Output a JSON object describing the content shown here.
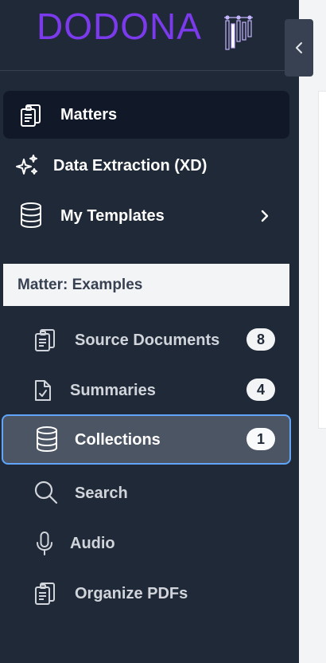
{
  "brand": {
    "logo_text": "DODONA"
  },
  "nav": {
    "matters": "Matters",
    "data_extraction": "Data Extraction (XD)",
    "my_templates": "My Templates"
  },
  "matter": {
    "section_title": "Matter: Examples",
    "items": [
      {
        "label": "Source Documents",
        "badge": "8"
      },
      {
        "label": "Summaries",
        "badge": "4"
      },
      {
        "label": "Collections",
        "badge": "1"
      },
      {
        "label": "Search"
      },
      {
        "label": "Audio"
      },
      {
        "label": "Organize PDFs"
      }
    ]
  },
  "colors": {
    "sidebar_bg": "#1f2937",
    "active_bg": "#111827",
    "logo": "#7c3aed",
    "focus_ring": "#60a5fa"
  }
}
